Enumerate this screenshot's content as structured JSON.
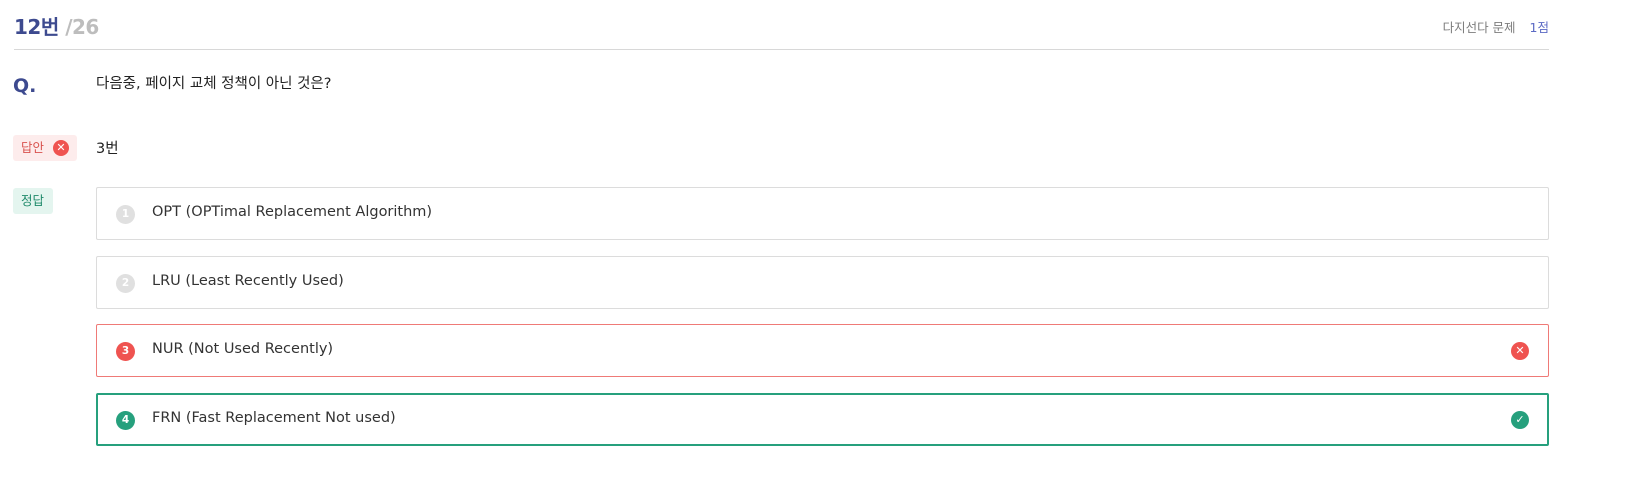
{
  "header": {
    "current": "12번",
    "total": "/26",
    "question_type": "다지선다 문제",
    "score": "1점"
  },
  "question": {
    "label": "Q.",
    "text": "다음중, 페이지 교체 정책이 아닌 것은?"
  },
  "answer": {
    "badge": "답안",
    "value": "3번"
  },
  "correct": {
    "badge": "정답"
  },
  "options": [
    {
      "num": "1",
      "text": "OPT (OPTimal Replacement Algorithm)"
    },
    {
      "num": "2",
      "text": "LRU (Least Recently Used)"
    },
    {
      "num": "3",
      "text": "NUR (Not Used Recently)"
    },
    {
      "num": "4",
      "text": "FRN (Fast Replacement Not used)"
    }
  ],
  "icons": {
    "wrong": "x-circle-icon",
    "right": "check-circle-icon"
  },
  "colors": {
    "accent": "#3d4a8f",
    "wrong": "#ef5350",
    "right": "#26a07d"
  }
}
